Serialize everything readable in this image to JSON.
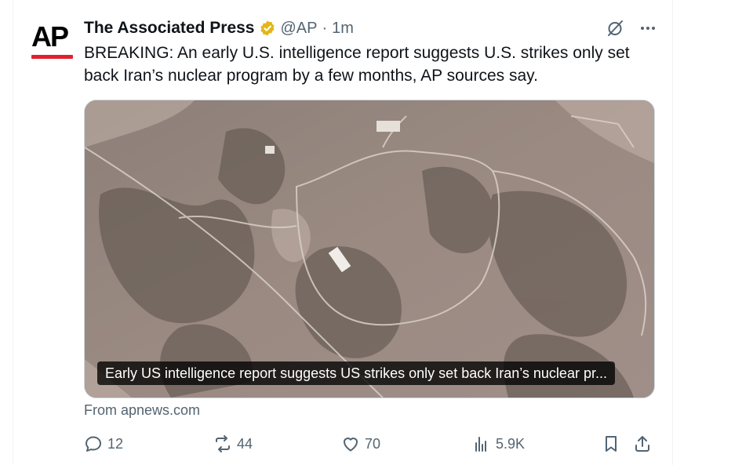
{
  "tweet": {
    "author_name": "The Associated Press",
    "handle": "@AP",
    "separator": "·",
    "time": "1m",
    "avatar_text": "AP",
    "text": "BREAKING: An early U.S. intelligence report suggests U.S. strikes only set back Iran’s nuclear program by a few months, AP sources say.",
    "media_caption": "Early US intelligence report suggests US strikes only set back Iran’s nuclear pr...",
    "source": "From apnews.com"
  },
  "actions": {
    "replies": "12",
    "reposts": "44",
    "likes": "70",
    "views": "5.9K"
  },
  "icons": [
    "verified-badge-icon",
    "grok-icon",
    "more-icon",
    "reply-icon",
    "repost-icon",
    "like-icon",
    "views-icon",
    "bookmark-icon",
    "share-icon"
  ],
  "colors": {
    "verified_gold": "#e2b719",
    "ap_red": "#e0212b",
    "secondary_text": "#536471",
    "primary_text": "#0f1419"
  }
}
